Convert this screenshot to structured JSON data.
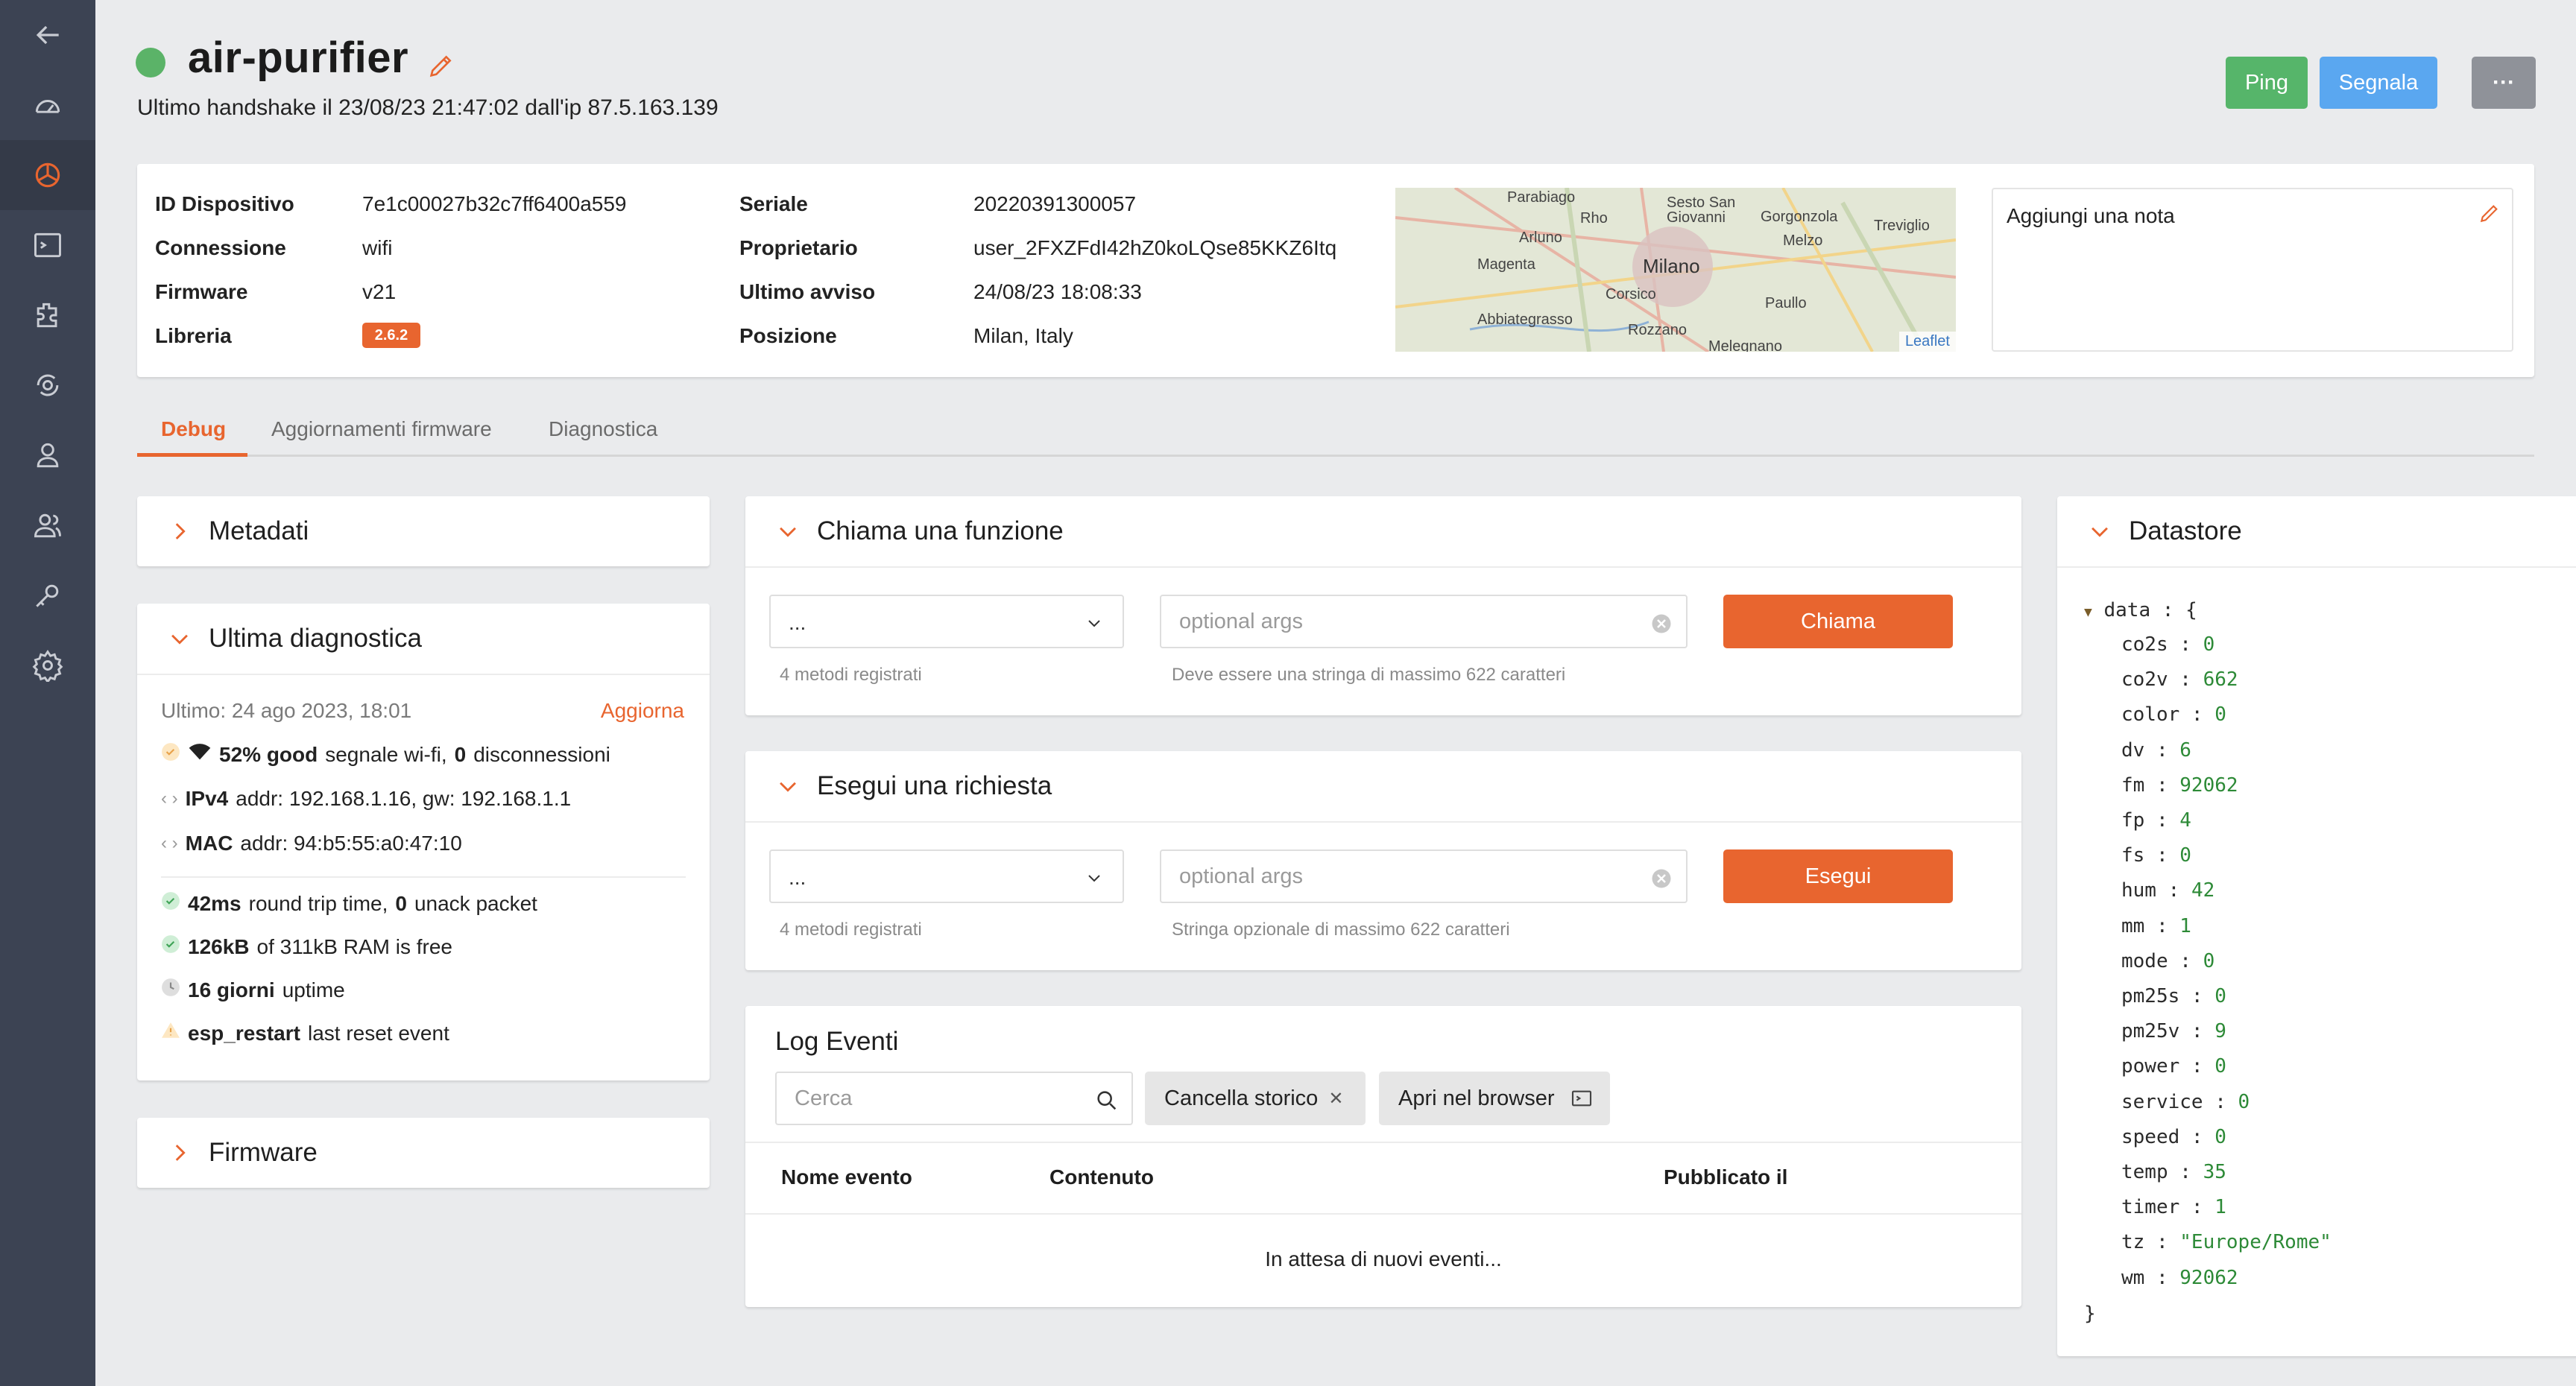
{
  "device": {
    "name": "air-purifier",
    "status_color": "#5bb368",
    "handshake": "Ultimo handshake il 23/08/23 21:47:02 dall'ip 87.5.163.139"
  },
  "actions": {
    "ping": "Ping",
    "report": "Segnala",
    "more": "···"
  },
  "info": {
    "left": [
      {
        "label": "ID Dispositivo",
        "value": "7e1c00027b32c7ff6400a559"
      },
      {
        "label": "Connessione",
        "value": "wifi"
      },
      {
        "label": "Firmware",
        "value": "v21"
      },
      {
        "label": "Libreria",
        "value": "2.6.2"
      }
    ],
    "right": [
      {
        "label": "Seriale",
        "value": "20220391300057"
      },
      {
        "label": "Proprietario",
        "value": "user_2FXZFdI42hZ0koLQse85KKZ6Itq"
      },
      {
        "label": "Ultimo avviso",
        "value": "24/08/23 18:08:33"
      },
      {
        "label": "Posizione",
        "value": "Milan, Italy"
      }
    ]
  },
  "map": {
    "places": [
      "Parabiago",
      "Sesto San Giovanni",
      "Gorgonzola",
      "Treviglio",
      "Rho",
      "Arluno",
      "Melzo",
      "Magenta",
      "Milano",
      "Corsico",
      "Paullo",
      "Abbiategrasso",
      "Rozzano",
      "Melegnano"
    ],
    "attribution": "Leaflet"
  },
  "note": {
    "placeholder": "Aggiungi una nota"
  },
  "tabs": [
    "Debug",
    "Aggiornamenti firmware",
    "Diagnostica"
  ],
  "metadata": {
    "title": "Metadati"
  },
  "diagnostics": {
    "title": "Ultima diagnostica",
    "last": "Ultimo: 24 ago 2023, 18:01",
    "refresh": "Aggiorna",
    "wifi_strong": "52% good",
    "wifi_text": "segnale wi-fi,",
    "wifi_disc": "0",
    "wifi_disc_text": "disconnessioni",
    "ipv4_label": "IPv4",
    "ipv4": "addr: 192.168.1.16, gw: 192.168.1.1",
    "mac_label": "MAC",
    "mac": "addr: 94:b5:55:a0:47:10",
    "rtt_strong": "42ms",
    "rtt_text": "round trip time,",
    "unack_strong": "0",
    "unack_text": "unack packet",
    "ram_strong": "126kB",
    "ram_text": "of 311kB RAM is free",
    "uptime_strong": "16 giorni",
    "uptime_text": "uptime",
    "reset_strong": "esp_restart",
    "reset_text": "last reset event"
  },
  "firmware": {
    "title": "Firmware"
  },
  "call_function": {
    "title": "Chiama una funzione",
    "select": "...",
    "placeholder": "optional args",
    "button": "Chiama",
    "methods": "4 metodi registrati",
    "hint": "Deve essere una stringa di massimo 622 caratteri"
  },
  "run_request": {
    "title": "Esegui una richiesta",
    "select": "...",
    "placeholder": "optional args",
    "button": "Esegui",
    "methods": "4 metodi registrati",
    "hint": "Stringa opzionale di massimo 622 caratteri"
  },
  "events": {
    "title": "Log Eventi",
    "search_placeholder": "Cerca",
    "clear": "Cancella storico",
    "open_browser": "Apri nel browser",
    "columns": [
      "Nome evento",
      "Contenuto",
      "Pubblicato il"
    ],
    "empty": "In attesa di nuovi eventi..."
  },
  "datastore": {
    "title": "Datastore",
    "root": "data",
    "entries": [
      {
        "key": "co2s",
        "value": "0"
      },
      {
        "key": "co2v",
        "value": "662"
      },
      {
        "key": "color",
        "value": "0"
      },
      {
        "key": "dv",
        "value": "6"
      },
      {
        "key": "fm",
        "value": "92062"
      },
      {
        "key": "fp",
        "value": "4"
      },
      {
        "key": "fs",
        "value": "0"
      },
      {
        "key": "hum",
        "value": "42"
      },
      {
        "key": "mm",
        "value": "1"
      },
      {
        "key": "mode",
        "value": "0"
      },
      {
        "key": "pm25s",
        "value": "0"
      },
      {
        "key": "pm25v",
        "value": "9"
      },
      {
        "key": "power",
        "value": "0"
      },
      {
        "key": "service",
        "value": "0"
      },
      {
        "key": "speed",
        "value": "0"
      },
      {
        "key": "temp",
        "value": "35"
      },
      {
        "key": "timer",
        "value": "1"
      },
      {
        "key": "tz",
        "value": "\"Europe/Rome\""
      },
      {
        "key": "wm",
        "value": "92062"
      }
    ]
  },
  "colors": {
    "accent": "#e8652f",
    "ping": "#56b56a",
    "report": "#5aa7f0",
    "sidebar": "#3c4353"
  }
}
